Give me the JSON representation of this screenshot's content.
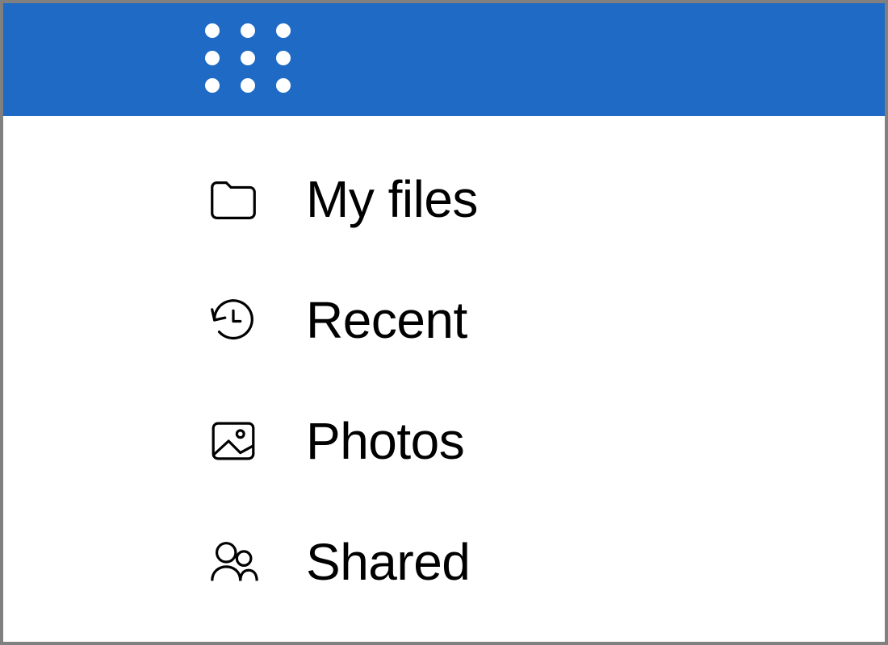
{
  "colors": {
    "header_bg": "#1E6AC4",
    "dot": "#ffffff",
    "text": "#000000"
  },
  "nav": {
    "items": [
      {
        "label": "My files",
        "icon": "folder-icon"
      },
      {
        "label": "Recent",
        "icon": "clock-history-icon"
      },
      {
        "label": "Photos",
        "icon": "image-icon"
      },
      {
        "label": "Shared",
        "icon": "people-icon"
      }
    ]
  }
}
